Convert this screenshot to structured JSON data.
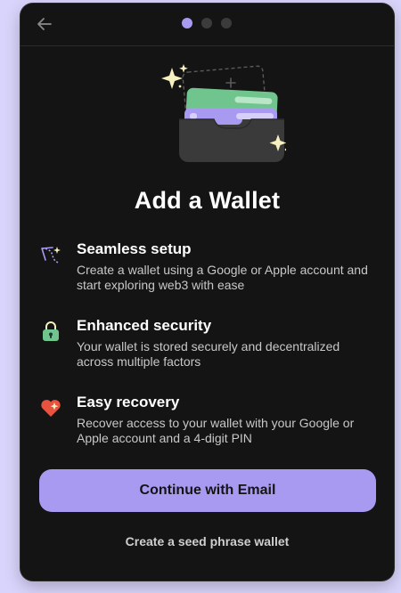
{
  "header": {
    "back_icon": "arrow-left-icon",
    "steps": {
      "total": 3,
      "current": 1
    }
  },
  "hero": {
    "icon": "wallet-with-cards-illustration"
  },
  "title": "Add a Wallet",
  "features": [
    {
      "icon": "dotted-path-icon",
      "heading": "Seamless setup",
      "description": "Create a wallet using a Google or Apple account and start exploring web3 with ease"
    },
    {
      "icon": "padlock-icon",
      "heading": "Enhanced security",
      "description": "Your wallet is stored securely and decentralized across multiple factors"
    },
    {
      "icon": "heart-icon",
      "heading": "Easy recovery",
      "description": "Recover access to your wallet with your Google or Apple account and a 4-digit PIN"
    }
  ],
  "actions": {
    "primary_label": "Continue with Email",
    "secondary_label": "Create a seed phrase wallet"
  },
  "colors": {
    "background": "#141414",
    "accent": "#a89af0",
    "card_green": "#6fc58d",
    "card_purple": "#a89af0",
    "heart_red": "#e8523f",
    "sparkle": "#f6f0c0"
  }
}
